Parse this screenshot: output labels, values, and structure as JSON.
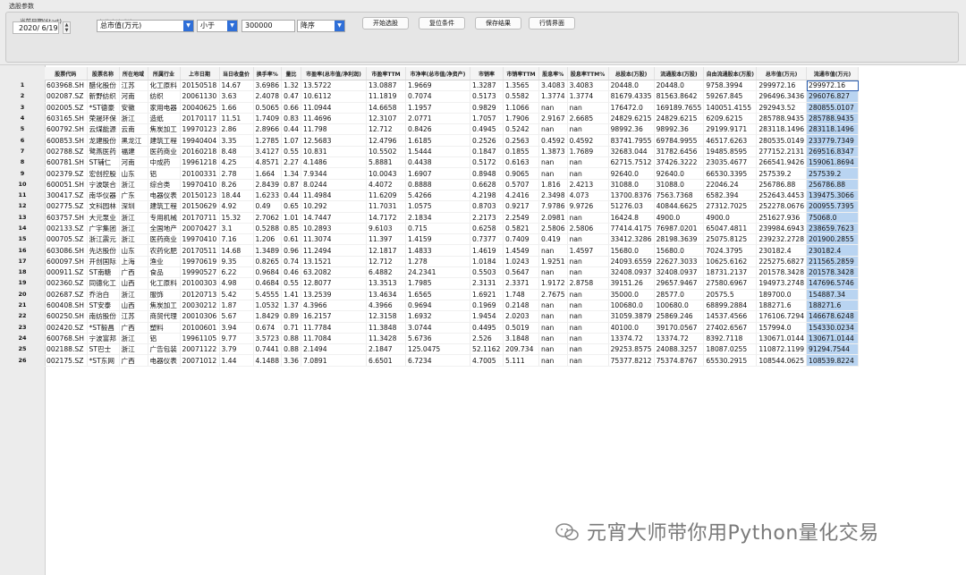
{
  "window": {
    "title": "选股参数"
  },
  "controls": {
    "start_label": "当前日期(Start)",
    "date_value": "2020/ 6/19",
    "condition_label": "条件表达式选股",
    "field_select": "总市值(万元)",
    "op_select": "小于",
    "threshold_value": "300000",
    "order_select": "降序",
    "buttons": {
      "start": "开始选股",
      "reset": "复位条件",
      "save": "保存结果",
      "market": "行情界面"
    }
  },
  "table": {
    "headers": [
      "股票代码",
      "股票名称",
      "所在地域",
      "所属行业",
      "上市日期",
      "当日收盘价",
      "换手率%",
      "量比",
      "市盈率(总市值/净利润)",
      "市盈率TTM",
      "市净率(总市值/净资产)",
      "市销率",
      "市销率TTM",
      "股息率%",
      "股息率TTM%",
      "总股本(万股)",
      "流通股本(万股)",
      "自由流通股本(万股)",
      "总市值(万元)",
      "流通市值(万元)"
    ],
    "rows": [
      [
        "1",
        "603968.SH",
        "醋化股份",
        "江苏",
        "化工原料",
        "20150518",
        "14.67",
        "3.6986",
        "1.32",
        "13.5722",
        "13.0887",
        "1.9669",
        "1.3287",
        "1.3565",
        "3.4083",
        "3.4083",
        "20448.0",
        "20448.0",
        "9758.3994",
        "299972.16",
        "299972.16"
      ],
      [
        "2",
        "002087.SZ",
        "新野纺织",
        "河南",
        "纺织",
        "20061130",
        "3.63",
        "2.4078",
        "0.47",
        "10.6112",
        "11.1819",
        "0.7074",
        "0.5173",
        "0.5582",
        "1.3774",
        "1.3774",
        "81679.4335",
        "81563.8642",
        "59267.845",
        "296496.3436",
        "296076.827"
      ],
      [
        "3",
        "002005.SZ",
        "*ST德豪",
        "安徽",
        "家用电器",
        "20040625",
        "1.66",
        "0.5065",
        "0.66",
        "11.0944",
        "14.6658",
        "1.1957",
        "0.9829",
        "1.1066",
        "nan",
        "nan",
        "176472.0",
        "169189.7655",
        "140051.4155",
        "292943.52",
        "280855.0107"
      ],
      [
        "4",
        "603165.SH",
        "荣晟环保",
        "浙江",
        "造纸",
        "20170117",
        "11.51",
        "1.7409",
        "0.83",
        "11.4696",
        "12.3107",
        "2.0771",
        "1.7057",
        "1.7906",
        "2.9167",
        "2.6685",
        "24829.6215",
        "24829.6215",
        "6209.6215",
        "285788.9435",
        "285788.9435"
      ],
      [
        "5",
        "600792.SH",
        "云煤能源",
        "云南",
        "焦炭加工",
        "19970123",
        "2.86",
        "2.8966",
        "0.44",
        "11.798",
        "12.712",
        "0.8426",
        "0.4945",
        "0.5242",
        "nan",
        "nan",
        "98992.36",
        "98992.36",
        "29199.9171",
        "283118.1496",
        "283118.1496"
      ],
      [
        "6",
        "600853.SH",
        "龙建股份",
        "黑龙江",
        "建筑工程",
        "19940404",
        "3.35",
        "1.2785",
        "1.07",
        "12.5683",
        "12.4796",
        "1.6185",
        "0.2526",
        "0.2563",
        "0.4592",
        "0.4592",
        "83741.7955",
        "69784.9955",
        "46517.6263",
        "280535.0149",
        "233779.7349"
      ],
      [
        "7",
        "002788.SZ",
        "鹭燕医药",
        "福建",
        "医药商业",
        "20160218",
        "8.48",
        "3.4127",
        "0.55",
        "10.831",
        "10.5502",
        "1.5444",
        "0.1847",
        "0.1855",
        "1.3873",
        "1.7689",
        "32683.044",
        "31782.6456",
        "19485.8595",
        "277152.2131",
        "269516.8347"
      ],
      [
        "8",
        "600781.SH",
        "ST辅仁",
        "河南",
        "中成药",
        "19961218",
        "4.25",
        "4.8571",
        "2.27",
        "4.1486",
        "5.8881",
        "0.4438",
        "0.5172",
        "0.6163",
        "nan",
        "nan",
        "62715.7512",
        "37426.3222",
        "23035.4677",
        "266541.9426",
        "159061.8694"
      ],
      [
        "9",
        "002379.SZ",
        "宏创控股",
        "山东",
        "铝",
        "20100331",
        "2.78",
        "1.664",
        "1.34",
        "7.9344",
        "10.0043",
        "1.6907",
        "0.8948",
        "0.9065",
        "nan",
        "nan",
        "92640.0",
        "92640.0",
        "66530.3395",
        "257539.2",
        "257539.2"
      ],
      [
        "10",
        "600051.SH",
        "宁波联合",
        "浙江",
        "综合类",
        "19970410",
        "8.26",
        "2.8439",
        "0.87",
        "8.0244",
        "4.4072",
        "0.8888",
        "0.6628",
        "0.5707",
        "1.816",
        "2.4213",
        "31088.0",
        "31088.0",
        "22046.24",
        "256786.88",
        "256786.88"
      ],
      [
        "11",
        "300417.SZ",
        "南华仪器",
        "广东",
        "电器仪表",
        "20150123",
        "18.44",
        "1.6233",
        "0.44",
        "11.4984",
        "11.6209",
        "5.4266",
        "4.2198",
        "4.2416",
        "2.3498",
        "4.073",
        "13700.8376",
        "7563.7368",
        "6582.394",
        "252643.4453",
        "139475.3066"
      ],
      [
        "12",
        "002775.SZ",
        "文科园林",
        "深圳",
        "建筑工程",
        "20150629",
        "4.92",
        "0.49",
        "0.65",
        "10.292",
        "11.7031",
        "1.0575",
        "0.8703",
        "0.9217",
        "7.9786",
        "9.9726",
        "51276.03",
        "40844.6625",
        "27312.7025",
        "252278.0676",
        "200955.7395"
      ],
      [
        "13",
        "603757.SH",
        "大元泵业",
        "浙江",
        "专用机械",
        "20170711",
        "15.32",
        "2.7062",
        "1.01",
        "14.7447",
        "14.7172",
        "2.1834",
        "2.2173",
        "2.2549",
        "2.0981",
        "nan",
        "16424.8",
        "4900.0",
        "4900.0",
        "251627.936",
        "75068.0"
      ],
      [
        "14",
        "002133.SZ",
        "广宇集团",
        "浙江",
        "全国地产",
        "20070427",
        "3.1",
        "0.5288",
        "0.85",
        "10.2893",
        "9.6103",
        "0.715",
        "0.6258",
        "0.5821",
        "2.5806",
        "2.5806",
        "77414.4175",
        "76987.0201",
        "65047.4811",
        "239984.6943",
        "238659.7623"
      ],
      [
        "15",
        "000705.SZ",
        "浙江震元",
        "浙江",
        "医药商业",
        "19970410",
        "7.16",
        "1.206",
        "0.61",
        "11.3074",
        "11.397",
        "1.4159",
        "0.7377",
        "0.7409",
        "0.419",
        "nan",
        "33412.3286",
        "28198.3639",
        "25075.8125",
        "239232.2728",
        "201900.2855"
      ],
      [
        "16",
        "603086.SH",
        "先达股份",
        "山东",
        "农药化肥",
        "20170511",
        "14.68",
        "1.3489",
        "0.96",
        "11.2494",
        "12.1817",
        "1.4833",
        "1.4619",
        "1.4549",
        "nan",
        "1.4597",
        "15680.0",
        "15680.0",
        "7024.3795",
        "230182.4",
        "230182.4"
      ],
      [
        "17",
        "600097.SH",
        "开创国际",
        "上海",
        "渔业",
        "19970619",
        "9.35",
        "0.8265",
        "0.74",
        "13.1521",
        "12.712",
        "1.278",
        "1.0184",
        "1.0243",
        "1.9251",
        "nan",
        "24093.6559",
        "22627.3033",
        "10625.6162",
        "225275.6827",
        "211565.2859"
      ],
      [
        "18",
        "000911.SZ",
        "ST南糖",
        "广西",
        "食品",
        "19990527",
        "6.22",
        "0.9684",
        "0.46",
        "63.2082",
        "6.4882",
        "24.2341",
        "0.5503",
        "0.5647",
        "nan",
        "nan",
        "32408.0937",
        "32408.0937",
        "18731.2137",
        "201578.3428",
        "201578.3428"
      ],
      [
        "19",
        "002360.SZ",
        "同德化工",
        "山西",
        "化工原料",
        "20100303",
        "4.98",
        "0.4684",
        "0.55",
        "12.8077",
        "13.3513",
        "1.7985",
        "2.3131",
        "2.3371",
        "1.9172",
        "2.8758",
        "39151.26",
        "29657.9467",
        "27580.6967",
        "194973.2748",
        "147696.5746"
      ],
      [
        "20",
        "002687.SZ",
        "乔治白",
        "浙江",
        "服饰",
        "20120713",
        "5.42",
        "5.4555",
        "1.41",
        "13.2539",
        "13.4634",
        "1.6565",
        "1.6921",
        "1.748",
        "2.7675",
        "nan",
        "35000.0",
        "28577.0",
        "20575.5",
        "189700.0",
        "154887.34"
      ],
      [
        "21",
        "600408.SH",
        "ST安泰",
        "山西",
        "焦炭加工",
        "20030212",
        "1.87",
        "1.0532",
        "1.37",
        "4.3966",
        "4.3966",
        "0.9694",
        "0.1969",
        "0.2148",
        "nan",
        "nan",
        "100680.0",
        "100680.0",
        "68899.2884",
        "188271.6",
        "188271.6"
      ],
      [
        "22",
        "600250.SH",
        "南纺股份",
        "江苏",
        "商贸代理",
        "20010306",
        "5.67",
        "1.8429",
        "0.89",
        "16.2157",
        "12.3158",
        "1.6932",
        "1.9454",
        "2.0203",
        "nan",
        "nan",
        "31059.3879",
        "25869.246",
        "14537.4566",
        "176106.7294",
        "146678.6248"
      ],
      [
        "23",
        "002420.SZ",
        "*ST毅昌",
        "广西",
        "塑料",
        "20100601",
        "3.94",
        "0.674",
        "0.71",
        "11.7784",
        "11.3848",
        "3.0744",
        "0.4495",
        "0.5019",
        "nan",
        "nan",
        "40100.0",
        "39170.0567",
        "27402.6567",
        "157994.0",
        "154330.0234"
      ],
      [
        "24",
        "600768.SH",
        "宁波富邦",
        "浙江",
        "铝",
        "19961105",
        "9.77",
        "3.5723",
        "0.88",
        "11.7084",
        "11.3428",
        "5.6736",
        "2.526",
        "3.1848",
        "nan",
        "nan",
        "13374.72",
        "13374.72",
        "8392.7118",
        "130671.0144",
        "130671.0144"
      ],
      [
        "25",
        "002188.SZ",
        "ST巴士",
        "浙江",
        "广告包装",
        "20071122",
        "3.79",
        "0.7441",
        "0.88",
        "2.1494",
        "2.1847",
        "125.0475",
        "52.1162",
        "209.734",
        "nan",
        "nan",
        "29253.8575",
        "24088.3257",
        "18087.0255",
        "110872.1199",
        "91294.7544"
      ],
      [
        "26",
        "002175.SZ",
        "*ST东网",
        "广西",
        "电器仪表",
        "20071012",
        "1.44",
        "4.1488",
        "3.36",
        "7.0891",
        "6.6501",
        "6.7234",
        "4.7005",
        "5.111",
        "nan",
        "nan",
        "75377.8212",
        "75374.8767",
        "65530.2915",
        "108544.0625",
        "108539.8224"
      ]
    ]
  },
  "watermark": {
    "text": "元宵大师带你用Python量化交易"
  }
}
